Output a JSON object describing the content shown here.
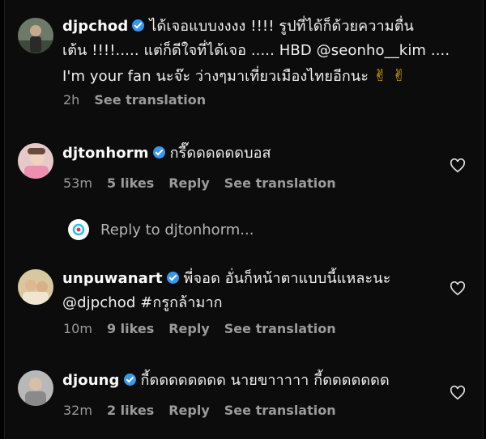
{
  "comments": [
    {
      "username": "djpchod",
      "line1": "ได้เจอแบบงงงง !!!! รูปที่ได้ก็ด้วยความตื่น",
      "line2": "เต้น !!!!..... แต่ก็ดีใจที่ได้เจอ ..... HBD @seonho__kim ....",
      "line3": "I'm your fan นะจ๊ะ ว่างๆมาเที่ยวเมืองไทยอีกนะ",
      "emoji": "✌ ✌",
      "time": "2h",
      "see_translation": "See translation"
    },
    {
      "username": "djtonhorm",
      "line1": "กรี๊ดดดดดดบอส",
      "time": "53m",
      "likes": "5 likes",
      "reply": "Reply",
      "see_translation": "See translation"
    },
    {
      "username": "unpuwanart",
      "line1": "พี่จอด อั่นก็หน้าตาแบบนี้แหละนะ",
      "line2": "@djpchod #กรูกล้ามาก",
      "time": "10m",
      "likes": "9 likes",
      "reply": "Reply",
      "see_translation": "See translation"
    },
    {
      "username": "djoung",
      "line1": "กี้ดดดดดดดด นายขาาาาา กี้ดดดดดดด",
      "time": "32m",
      "likes": "2 likes",
      "reply": "Reply",
      "see_translation": "See translation"
    }
  ],
  "reply_to": "Reply to djtonhorm...",
  "colors": {
    "verified": "#3897f0",
    "meta_text": "#9b9b9b",
    "background": "#0c0c0c"
  },
  "icons": [
    "verified-badge-icon",
    "heart-icon",
    "reply-app-icon"
  ]
}
